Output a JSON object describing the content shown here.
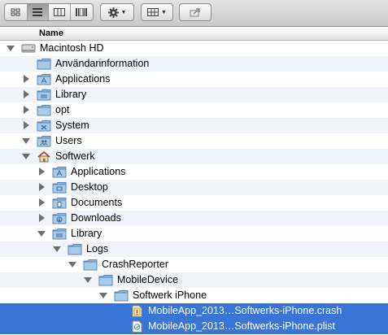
{
  "toolbar": {
    "view_buttons": [
      "icon-view-icon",
      "list-view-icon",
      "column-view-icon",
      "coverflow-view-icon"
    ],
    "action_button": "gear-icon",
    "arrange_button": "arrange-grid-icon",
    "share_button": "share-icon"
  },
  "header": {
    "name": "Name"
  },
  "rows": [
    {
      "label": "Macintosh HD",
      "icon": "hard-drive-icon",
      "expanded": true
    },
    {
      "label": "Användarinformation",
      "icon": "folder-icon"
    },
    {
      "label": "Applications",
      "icon": "applications-folder-icon",
      "expanded": false
    },
    {
      "label": "Library",
      "icon": "library-folder-icon",
      "expanded": false
    },
    {
      "label": "opt",
      "icon": "folder-icon",
      "expanded": false
    },
    {
      "label": "System",
      "icon": "system-folder-icon",
      "expanded": false
    },
    {
      "label": "Users",
      "icon": "users-folder-icon",
      "expanded": true
    },
    {
      "label": "Softwerk",
      "icon": "home-icon",
      "expanded": true
    },
    {
      "label": "Applications",
      "icon": "applications-folder-icon",
      "expanded": false
    },
    {
      "label": "Desktop",
      "icon": "desktop-folder-icon",
      "expanded": false
    },
    {
      "label": "Documents",
      "icon": "documents-folder-icon",
      "expanded": false
    },
    {
      "label": "Downloads",
      "icon": "downloads-folder-icon",
      "expanded": false
    },
    {
      "label": "Library",
      "icon": "library-folder-icon",
      "expanded": true
    },
    {
      "label": "Logs",
      "icon": "folder-icon",
      "expanded": true
    },
    {
      "label": "CrashReporter",
      "icon": "folder-icon",
      "expanded": true
    },
    {
      "label": "MobileDevice",
      "icon": "folder-icon",
      "expanded": true
    },
    {
      "label": "Softwerk iPhone",
      "icon": "folder-icon",
      "expanded": true
    },
    {
      "label": "MobileApp_2013…Softwerks-iPhone.crash",
      "icon": "crash-file-icon",
      "selected": true
    },
    {
      "label": "MobileApp_2013…Softwerks-iPhone.plist",
      "icon": "plist-file-icon",
      "selected": true
    }
  ]
}
